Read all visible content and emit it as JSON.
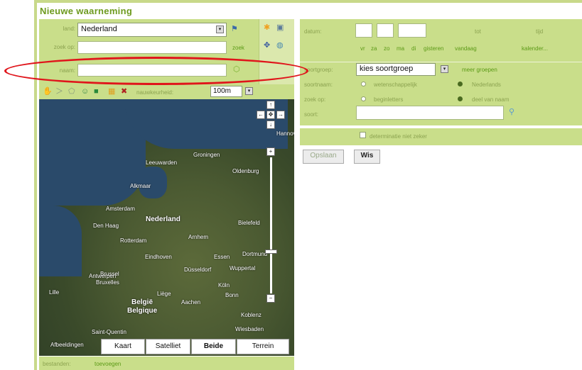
{
  "title": "Nieuwe waarneming",
  "location": {
    "land_label": "land:",
    "land_value": "Nederland",
    "zoek_label": "zoek op:",
    "zoek_link": "zoek",
    "naam_label": "naam:"
  },
  "toolbar": {
    "precision_label": "nauwkeurheid:",
    "precision_value": "100m"
  },
  "map": {
    "cities": [
      "Groningen",
      "Leeuwarden",
      "Oldenburg",
      "Alkmaar",
      "Amsterdam",
      "Nederland",
      "Den Haag",
      "Rotterdam",
      "Arnhem",
      "Bielefeld",
      "Eindhoven",
      "Essen",
      "Dortmund",
      "Wuppertal",
      "Düsseldorf",
      "Antwerpen",
      "Brussel",
      "Bruxelles",
      "Köln",
      "Bonn",
      "Aachen",
      "Lille",
      "Liège",
      "België",
      "Belgique",
      "Koblenz",
      "Wiesbaden",
      "Saint-Quentin",
      "Hannover"
    ],
    "attribution": "Afbeeldingen",
    "type_buttons": [
      "Kaart",
      "Satelliet",
      "Beide",
      "Terrein"
    ]
  },
  "date": {
    "datum_label": "datum:",
    "tot_label": "tot",
    "tijd_label": "tijd",
    "quick_links": [
      "vr",
      "za",
      "zo",
      "ma",
      "di",
      "gisteren",
      "vandaag",
      "kalender..."
    ]
  },
  "species": {
    "group_label": "soortgroep:",
    "group_value": "kies soortgroep",
    "more_groups_link": "meer groepen",
    "name_label": "soortnaam:",
    "name_options": [
      "wetenschappelijk",
      "Nederlands"
    ],
    "search_label": "zoek op:",
    "search_options": [
      "beginletters",
      "deel van naam"
    ],
    "soort_label": "soort:"
  },
  "determination_label": "determinatie niet zeker",
  "actions": {
    "save": "Opslaan",
    "clear": "Wis"
  },
  "footer": {
    "label": "bestanden:",
    "link": "toevoegen"
  }
}
